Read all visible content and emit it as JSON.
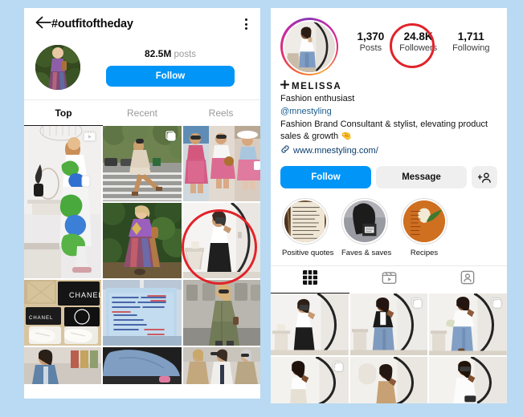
{
  "theme": {
    "page_background": "#b9daf2",
    "instagram_blue": "#0095f6",
    "annotation_red": "#e1232a",
    "muted_grey": "#9a9a9a"
  },
  "hashtag_screen": {
    "back_icon": "back-arrow-icon",
    "title": "#outfitoftheday",
    "menu_icon": "more-options-icon",
    "post_count": "82.5M",
    "post_count_label": "posts",
    "follow_label": "Follow",
    "tabs": [
      {
        "label": "Top",
        "active": true
      },
      {
        "label": "Recent",
        "active": false
      },
      {
        "label": "Reels",
        "active": false
      }
    ],
    "grid": {
      "row1": [
        {
          "name": "tall-post-green-floral-dress",
          "badge": "reels-icon"
        },
        {
          "name": "post-beige-dress-crosswalk",
          "badge": "carousel-icon"
        },
        {
          "name": "post-pink-skirt-trio",
          "badge": null
        }
      ],
      "row2": [
        {
          "name": "post-purple-jacket-garden",
          "badge": null
        },
        {
          "name": "post-white-top-mirror-selfie",
          "badge": null,
          "annotated": true
        }
      ],
      "row3": [
        {
          "name": "post-chanel-shoes-boxes",
          "badge": null
        },
        {
          "name": "post-protest-sign-banner",
          "badge": null
        },
        {
          "name": "post-khaki-jumpsuit-street",
          "badge": null
        }
      ],
      "row4": [
        {
          "name": "post-denim-jacket-store",
          "badge": null
        },
        {
          "name": "post-jeans-closeup",
          "badge": null
        },
        {
          "name": "post-trench-coat-trio",
          "badge": null
        }
      ]
    }
  },
  "profile_screen": {
    "avatar": "profile-avatar-mirror-selfie",
    "stats": [
      {
        "value": "1,370",
        "label": "Posts",
        "annotated": false
      },
      {
        "value": "24.8K",
        "label": "Followers",
        "annotated": true
      },
      {
        "value": "1,711",
        "label": "Following",
        "annotated": false
      }
    ],
    "bio": {
      "verified_icon": "plus-badge-icon",
      "name": "MELISSA",
      "category": "Fashion enthusiast",
      "handle": "@mnestyling",
      "description": "Fashion Brand Consultant & stylist, elevating product sales & growth",
      "description_emoji": "🤏",
      "link_icon": "link-icon",
      "link": "www.mnestyling.com/"
    },
    "actions": {
      "follow_label": "Follow",
      "message_label": "Message",
      "add_person_icon": "add-person-icon"
    },
    "highlights": [
      {
        "label": "Positive quotes",
        "name": "highlight-positive-quotes"
      },
      {
        "label": "Faves & saves",
        "name": "highlight-faves-saves"
      },
      {
        "label": "Recipes",
        "name": "highlight-recipes"
      }
    ],
    "tabs": [
      {
        "icon": "grid-icon",
        "active": true
      },
      {
        "icon": "reels-icon",
        "active": false
      },
      {
        "icon": "tagged-icon",
        "active": false
      }
    ],
    "posts": [
      {
        "name": "post-white-tank-black-trousers",
        "badge": null
      },
      {
        "name": "post-black-blazer-wide-jeans",
        "badge": "carousel-icon"
      },
      {
        "name": "post-white-shirt-blue-jeans",
        "badge": "carousel-icon"
      },
      {
        "name": "post-white-strapless-top",
        "badge": "carousel-icon"
      },
      {
        "name": "post-camel-coat-mirror",
        "badge": null
      },
      {
        "name": "post-white-oversized-shirt",
        "badge": null
      }
    ]
  }
}
